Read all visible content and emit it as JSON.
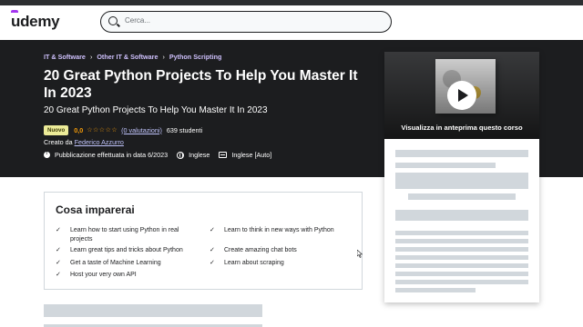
{
  "header": {
    "logo": "udemy",
    "search_placeholder": "Cerca..."
  },
  "course": {
    "breadcrumbs": [
      "IT & Software",
      "Other IT & Software",
      "Python Scripting"
    ],
    "title": "20 Great Python Projects To Help You Master It In 2023",
    "subtitle": "20 Great Python Projects To Help You Master It In 2023",
    "badge": "Nuovo",
    "rating": "0,0",
    "stars": "☆☆☆☆☆",
    "reviews": "(0 valutazioni)",
    "students": "639 studenti",
    "creator_prefix": "Creato da",
    "creator_name": "Federico Azzurro",
    "published": "Pubblicazione effettuata in data 6/2023",
    "language": "Inglese",
    "captions": "Inglese [Auto]"
  },
  "sidebar": {
    "preview_label": "Visualizza in anteprima questo corso"
  },
  "learn": {
    "title": "Cosa imparerai",
    "check_glyph": "✓",
    "items": [
      "Learn how to start using Python in real projects",
      "Learn to think in new ways with Python",
      "Learn great tips and tricks about Python",
      "Create amazing chat bots",
      "Get a taste of Machine Learning",
      "Learn about scraping",
      "Host your very own API"
    ]
  },
  "colors": {
    "accent": "#a435f0",
    "hero_bg": "#1c1d1f",
    "link_purple": "#c0c4fc",
    "star": "#f69c08",
    "badge_bg": "#eceb98"
  }
}
